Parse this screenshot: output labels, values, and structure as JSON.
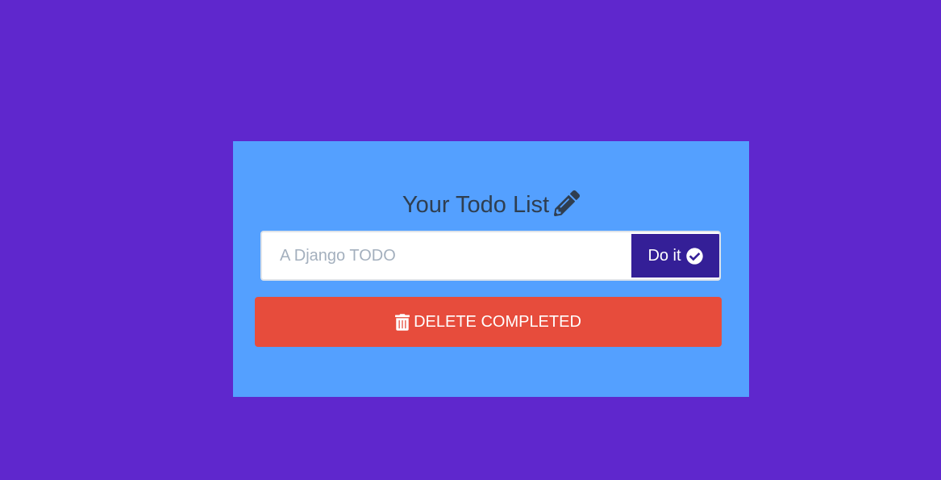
{
  "header": {
    "title": "Your Todo List",
    "title_icon": "pencil-icon"
  },
  "form": {
    "input_placeholder": "A Django TODO",
    "input_value": "",
    "submit_label": "Do it",
    "submit_icon": "check-circle-icon"
  },
  "actions": {
    "delete_label": "DELETE COMPLETED",
    "delete_icon": "trash-icon"
  },
  "colors": {
    "page_background": "#5f27cd",
    "card_background": "#54a0ff",
    "submit_button": "#341f97",
    "delete_button": "#e74c3c",
    "title_text": "#2f3e50"
  }
}
